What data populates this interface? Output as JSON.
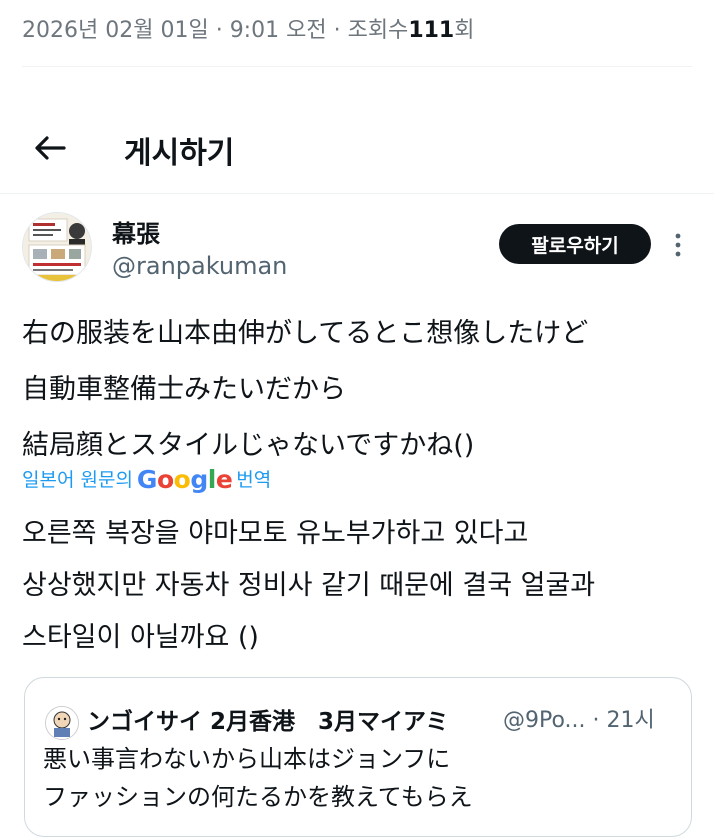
{
  "meta_line": {
    "date": "2026년 02월 01일",
    "time": "9:01 오전",
    "views_label": "조회수",
    "views_count": "111",
    "views_suffix": "회",
    "separator": "·"
  },
  "header": {
    "title": "게시하기",
    "back_icon": "arrow-left-icon"
  },
  "author": {
    "name": "幕張",
    "handle": "@ranpakuman"
  },
  "follow_button": "팔로우하기",
  "more_icon": "more-vertical-icon",
  "post": {
    "lines": [
      "右の服装を山本由伸がしてるとこ想像したけど",
      "自動車整備士みたいだから",
      "結局顔とスタイルじゃないですかね()"
    ]
  },
  "translation": {
    "prefix": "일본어 원문의",
    "brand": [
      "G",
      "o",
      "o",
      "g",
      "l",
      "e"
    ],
    "suffix": "번역",
    "lines": [
      "오른쪽 복장을 야마모토 유노부가하고 있다고",
      "상상했지만 자동차 정비사 같기 때문에 결국 얼굴과",
      "스타일이 아닐까요 ()"
    ]
  },
  "quote": {
    "author_name": "ンゴイサイ 2月香港　3月マイアミ",
    "handle": "@9Po...",
    "separator": "·",
    "time": "21시",
    "lines": [
      "悪い事言わないから山本はジョンフに",
      "ファッションの何たるかを教えてもらえ"
    ]
  }
}
